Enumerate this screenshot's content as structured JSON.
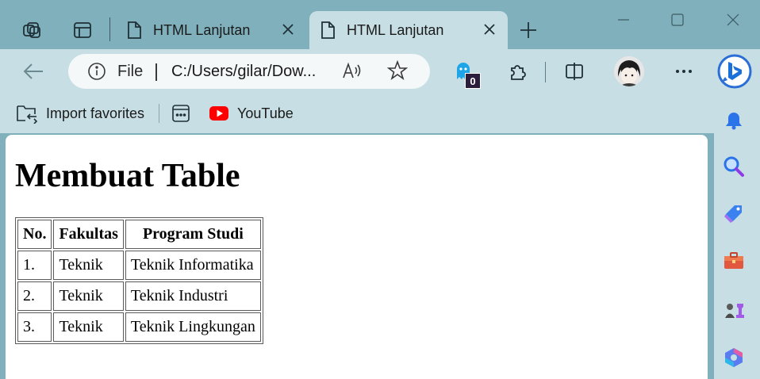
{
  "tabs": [
    {
      "title": "HTML Lanjutan",
      "active": false
    },
    {
      "title": "HTML Lanjutan",
      "active": true
    }
  ],
  "address": {
    "scheme_label": "File",
    "url": "C:/Users/gilar/Dow..."
  },
  "extensions": {
    "ghostery_count": "0"
  },
  "favorites": [
    {
      "label": "Import favorites",
      "icon": "import-favorites-icon"
    },
    {
      "label": "",
      "icon": "collections-app-icon"
    },
    {
      "label": "YouTube",
      "icon": "youtube-icon"
    }
  ],
  "sidebar": {
    "icons": [
      "bell-icon",
      "search-icon",
      "shopping-tag-icon",
      "toolbox-icon",
      "games-icon",
      "office-icon"
    ]
  },
  "page": {
    "heading": "Membuat Table",
    "table": {
      "headers": [
        "No.",
        "Fakultas",
        "Program Studi"
      ],
      "rows": [
        [
          "1.",
          "Teknik",
          "Teknik Informatika"
        ],
        [
          "2.",
          "Teknik",
          "Teknik Industri"
        ],
        [
          "3.",
          "Teknik",
          "Teknik Lingkungan"
        ]
      ]
    }
  },
  "colors": {
    "frame": "#7fb0bc",
    "toolbar": "#c7dfe4",
    "youtube_red": "#ff0000"
  }
}
